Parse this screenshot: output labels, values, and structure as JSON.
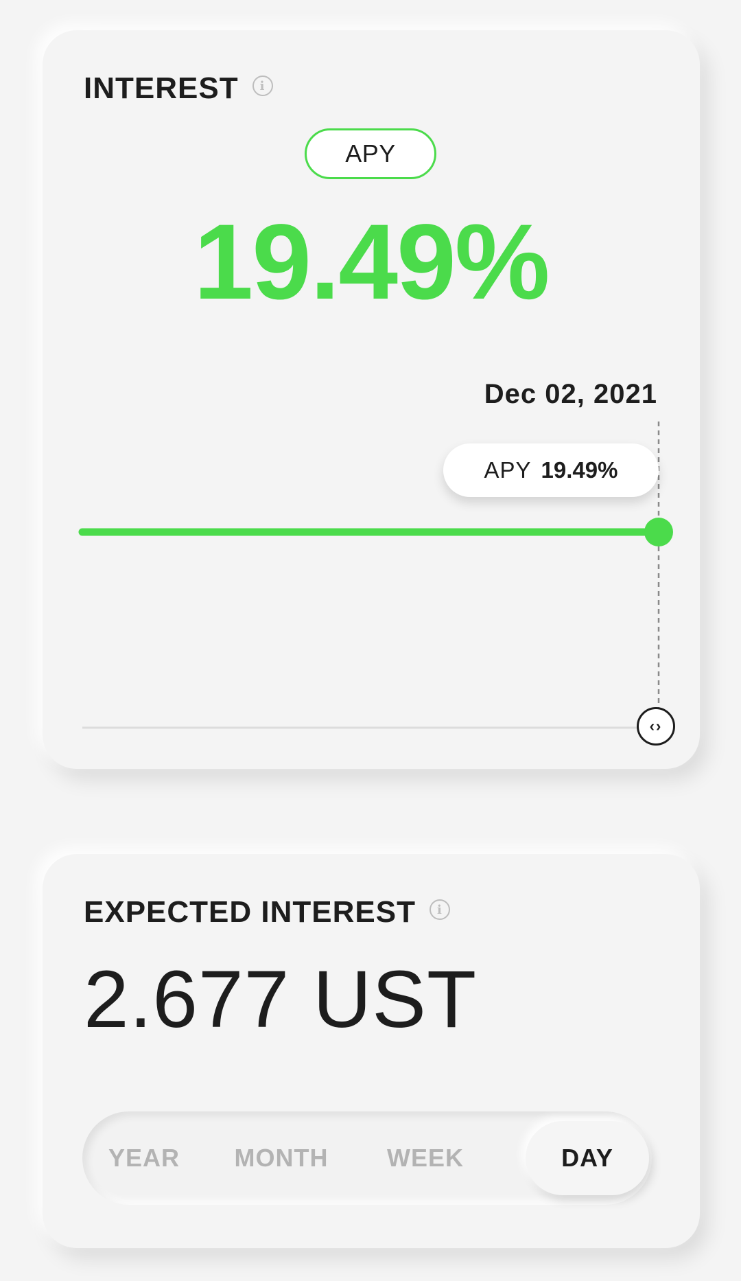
{
  "interest": {
    "title": "INTEREST",
    "info_icon": "info-icon",
    "toggle_label": "APY",
    "apy_value": "19.49%",
    "chart": {
      "date_label": "Dec 02, 2021",
      "tooltip_label": "APY",
      "tooltip_value": "19.49%",
      "line_color": "#4bdb4b",
      "handle_icon": "arrows-horizontal-icon",
      "handle_glyph": "‹›"
    }
  },
  "expected_interest": {
    "title": "EXPECTED INTEREST",
    "info_icon": "info-icon",
    "value": "2.677 UST",
    "tabs": [
      {
        "label": "YEAR",
        "active": false
      },
      {
        "label": "MONTH",
        "active": false
      },
      {
        "label": "WEEK",
        "active": false
      },
      {
        "label": "DAY",
        "active": true
      }
    ]
  },
  "colors": {
    "accent": "#4bdb4b",
    "background": "#f4f4f4",
    "text": "#1d1d1d",
    "muted": "#b3b3b3"
  }
}
